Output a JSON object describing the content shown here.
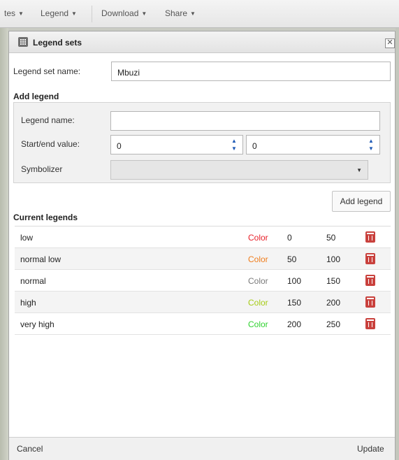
{
  "menu": {
    "items": [
      {
        "label": "tes"
      },
      {
        "label": "Legend"
      },
      {
        "label": "Download"
      },
      {
        "label": "Share"
      }
    ]
  },
  "window": {
    "title": "Legend sets",
    "close_label": "✕"
  },
  "form": {
    "set_name_label": "Legend set name:",
    "set_name_value": "Mbuzi",
    "add_legend_title": "Add legend",
    "legend_name_label": "Legend name:",
    "legend_name_value": "",
    "start_end_label": "Start/end value:",
    "start_value": "0",
    "end_value": "0",
    "symbolizer_label": "Symbolizer",
    "symbolizer_value": "",
    "add_button_label": "Add legend"
  },
  "current": {
    "title": "Current legends",
    "rows": [
      {
        "name": "low",
        "color_label": "Color",
        "color": "#e8202a",
        "start": "0",
        "end": "50"
      },
      {
        "name": "normal low",
        "color_label": "Color",
        "color": "#f07d1c",
        "start": "50",
        "end": "100"
      },
      {
        "name": "normal",
        "color_label": "Color",
        "color": "#7a7a7a",
        "start": "100",
        "end": "150"
      },
      {
        "name": "high",
        "color_label": "Color",
        "color": "#a6cc16",
        "start": "150",
        "end": "200"
      },
      {
        "name": "very high",
        "color_label": "Color",
        "color": "#2fd22f",
        "start": "200",
        "end": "250"
      }
    ]
  },
  "footer": {
    "cancel_label": "Cancel",
    "update_label": "Update"
  },
  "icons": {
    "delete": "trash-icon",
    "window": "grid-icon"
  }
}
